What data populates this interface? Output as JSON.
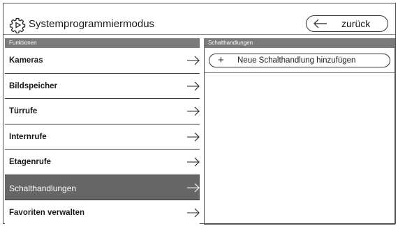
{
  "header": {
    "title": "Systemprogrammiermodus",
    "back_label": "zurück"
  },
  "left_column": {
    "heading": "Funktionen",
    "items": [
      {
        "label": "Kameras",
        "active": false
      },
      {
        "label": "Bildspeicher",
        "active": false
      },
      {
        "label": "Türrufe",
        "active": false
      },
      {
        "label": "Internrufe",
        "active": false
      },
      {
        "label": "Etagenrufe",
        "active": false
      },
      {
        "label": "Schalthandlungen",
        "active": true
      },
      {
        "label": "Favoriten verwalten",
        "active": false
      }
    ]
  },
  "right_column": {
    "heading": "Schalthandlungen",
    "add_button_label": "Neue Schalthandlung hinzufügen",
    "add_button_icon": "+"
  },
  "colors": {
    "active_item_bg": "#666666",
    "column_header_bg": "#7a7a7a"
  }
}
